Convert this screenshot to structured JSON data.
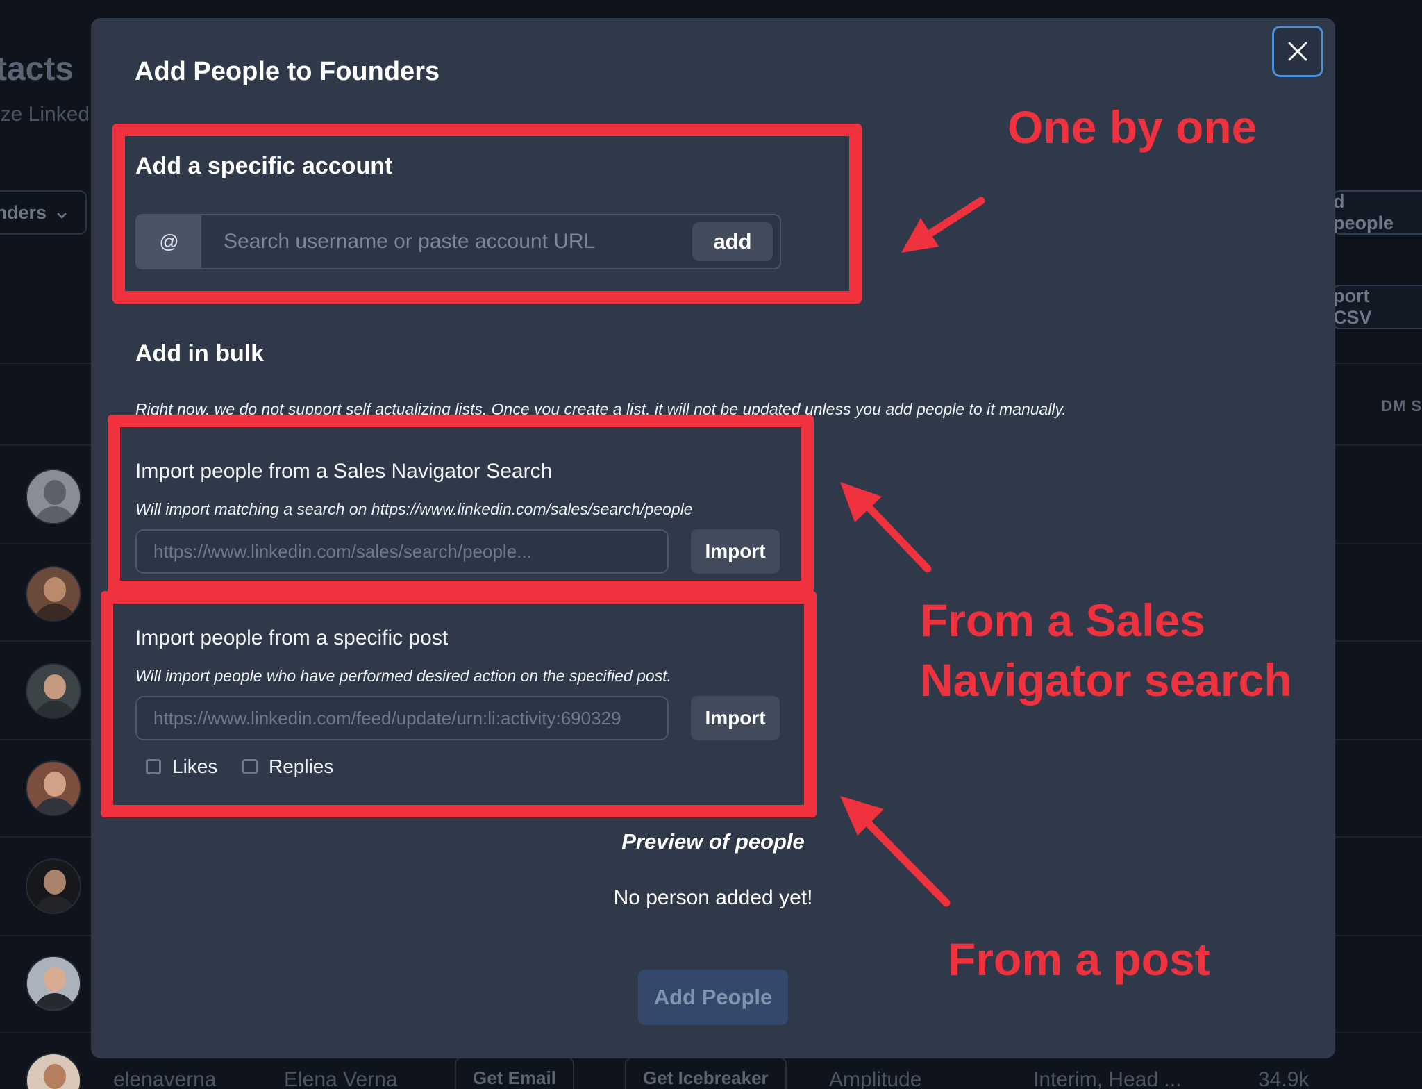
{
  "background": {
    "page_title": "tacts",
    "page_subtitle": "ize Linked",
    "list_selector": "nders",
    "add_people_btn": "d people",
    "import_csv_btn": "port CSV",
    "column_header": "DM S",
    "row": {
      "username": "elenaverna",
      "name": "Elena Verna",
      "get_email": "Get Email",
      "get_icebreaker": "Get Icebreaker",
      "company": "Amplitude",
      "title": "Interim, Head ...",
      "followers": "34.9k"
    }
  },
  "modal": {
    "title": "Add People to Founders",
    "specific": {
      "heading": "Add a specific account",
      "prefix": "@",
      "placeholder": "Search username or paste account URL",
      "add_label": "add"
    },
    "bulk": {
      "heading": "Add in bulk",
      "note": "Right now, we do not support self actualizing lists. Once you create a list, it will not be updated unless you add people to it manually.",
      "sales_nav": {
        "title": "Import people from a Sales Navigator Search",
        "note": "Will import matching a search on https://www.linkedin.com/sales/search/people",
        "placeholder": "https://www.linkedin.com/sales/search/people...",
        "button": "Import"
      },
      "post": {
        "title": "Import people from a specific post",
        "note": "Will import people who have performed desired action on the specified post.",
        "placeholder": "https://www.linkedin.com/feed/update/urn:li:activity:690329",
        "button": "Import",
        "options": [
          "Likes",
          "Replies"
        ]
      }
    },
    "preview_label": "Preview of people",
    "empty_message": "No person added yet!",
    "submit_label": "Add People"
  },
  "annotations": {
    "one_by_one": "One by one",
    "sales_nav_line1": "From a Sales",
    "sales_nav_line2": "Navigator search",
    "from_post": "From a post",
    "color": "#f0323f"
  }
}
